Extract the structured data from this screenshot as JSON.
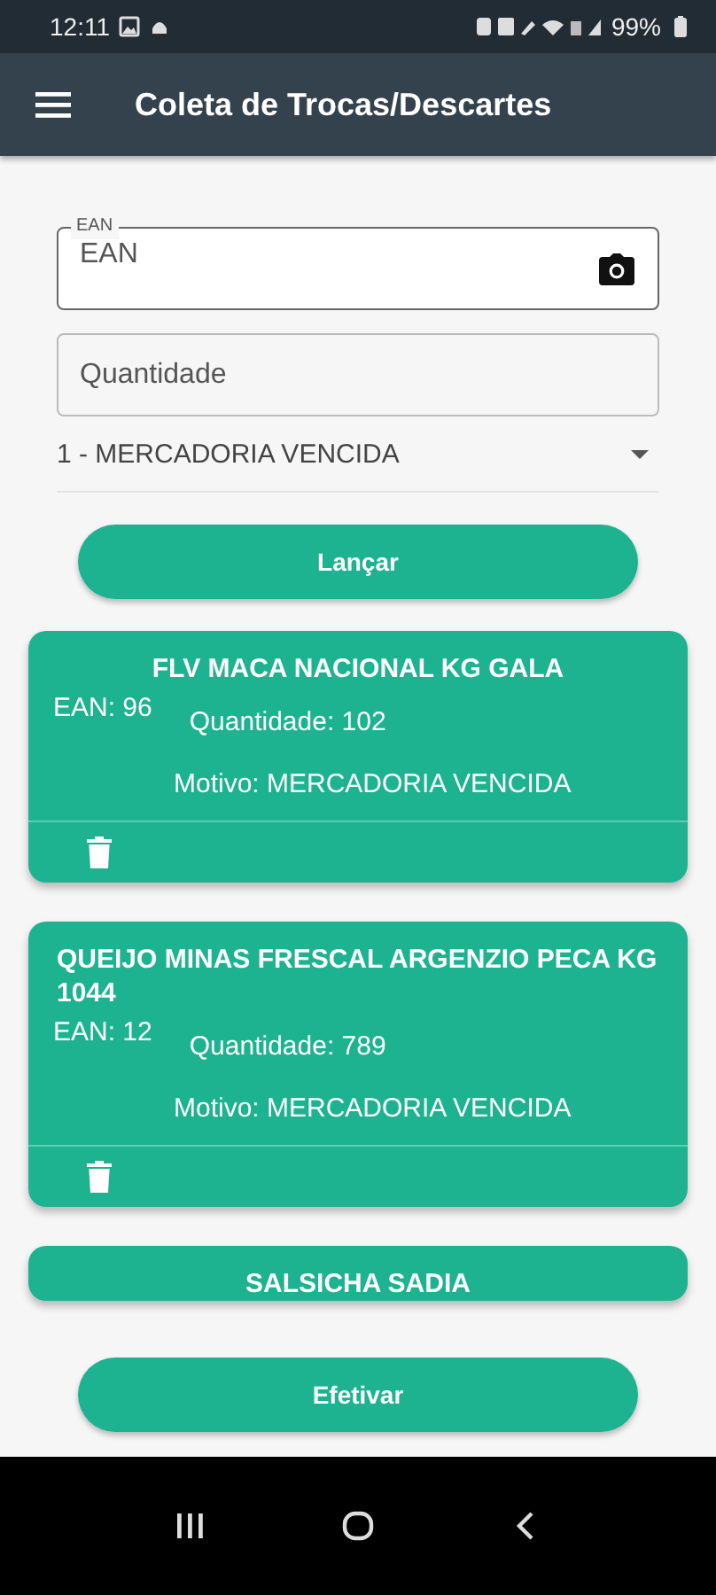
{
  "status_bar": {
    "time": "12:11",
    "battery": "99%"
  },
  "app_bar": {
    "title": "Coleta de Trocas/Descartes"
  },
  "form": {
    "ean": {
      "label": "EAN",
      "placeholder": "EAN"
    },
    "quantity": {
      "placeholder": "Quantidade"
    },
    "reason": {
      "value": "1 - MERCADORIA VENCIDA"
    },
    "submit_button": "Lançar"
  },
  "items": [
    {
      "name": "FLV  MACA NACIONAL KG GALA",
      "ean": "EAN: 96",
      "quantity": "Quantidade: 102",
      "reason": "Motivo: MERCADORIA VENCIDA"
    },
    {
      "name": "QUEIJO MINAS FRESCAL ARGENZIO PECA KG 1044",
      "ean": "EAN: 12",
      "quantity": "Quantidade: 789",
      "reason": "Motivo: MERCADORIA VENCIDA"
    },
    {
      "name": "SALSICHA SADIA"
    }
  ],
  "confirm_button": "Efetivar"
}
